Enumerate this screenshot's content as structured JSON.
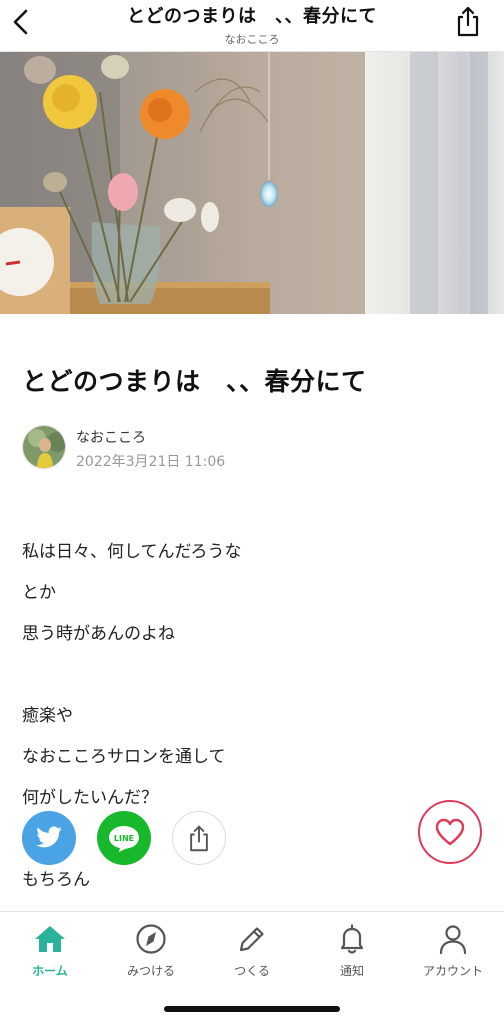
{
  "header": {
    "title": "とどのつまりは　、、春分にて",
    "author": "なおこころ",
    "back_icon": "chevron-left-icon",
    "share_icon": "share-icon"
  },
  "article": {
    "title": "とどのつまりは　、、春分にて",
    "author_name": "なおこころ",
    "date": "2022年3月21日 11:06",
    "paragraphs": [
      [
        "私は日々、何してんだろうな",
        "とか",
        "思う時があんのよね"
      ],
      [
        "癒楽や",
        "なおこころサロンを通して",
        "何がしたいんだ？",
        "",
        "もちろん"
      ]
    ]
  },
  "share": {
    "twitter_icon": "twitter-icon",
    "line_label": "LINE",
    "share_icon": "share-icon"
  },
  "like": {
    "icon": "heart-icon",
    "color": "#e03a5b"
  },
  "bottom_nav": {
    "accent": "#2bb39a",
    "items": [
      {
        "label": "ホーム",
        "icon": "home-icon"
      },
      {
        "label": "みつける",
        "icon": "compass-icon"
      },
      {
        "label": "つくる",
        "icon": "pencil-icon"
      },
      {
        "label": "通知",
        "icon": "bell-icon"
      },
      {
        "label": "アカウント",
        "icon": "person-icon"
      }
    ]
  }
}
